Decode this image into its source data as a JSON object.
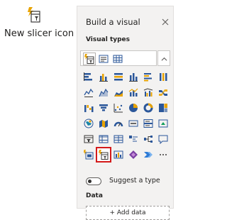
{
  "callout": {
    "label": "New slicer icon",
    "icon": "new-slicer-icon"
  },
  "pane": {
    "title": "Build a visual",
    "close_icon": "close-icon",
    "visual_types_label": "Visual types",
    "collapse_icon": "chevron-up-icon",
    "suggest_label": "Suggest a type",
    "suggest_on": false,
    "data_label": "Data",
    "add_data_label": "+ Add data"
  },
  "visual_rows": [
    [
      "new-slicer-icon",
      "text-slicer-icon",
      "table-visual-icon"
    ],
    [
      "stacked-bar-icon",
      "clustered-column-icon",
      "stacked-bar-100-icon",
      "stacked-column-icon",
      "clustered-bar-icon",
      "column-100-icon"
    ],
    [
      "line-chart-icon",
      "area-chart-icon",
      "stacked-area-icon",
      "line-column-icon",
      "line-clustered-icon",
      "ribbon-chart-icon"
    ],
    [
      "waterfall-icon",
      "funnel-icon",
      "scatter-icon",
      "pie-chart-icon",
      "donut-chart-icon",
      "treemap-icon"
    ],
    [
      "map-icon",
      "filled-map-icon",
      "gauge-icon",
      "card-icon",
      "multi-row-card-icon",
      "kpi-icon"
    ],
    [
      "slicer-icon",
      "matrix-icon",
      "table-icon",
      "key-influencers-icon",
      "decomposition-tree-icon",
      "narrative-icon"
    ],
    [
      "button-slicer-icon",
      "new-slicer-icon",
      "python-visual-icon",
      "power-apps-icon",
      "power-automate-icon",
      "more-icon"
    ]
  ],
  "colors": {
    "accent_yellow": "#e8a300",
    "accent_blue": "#2b579a",
    "highlight_red": "#d41a1a",
    "pane_bg": "#f3f2f1"
  }
}
